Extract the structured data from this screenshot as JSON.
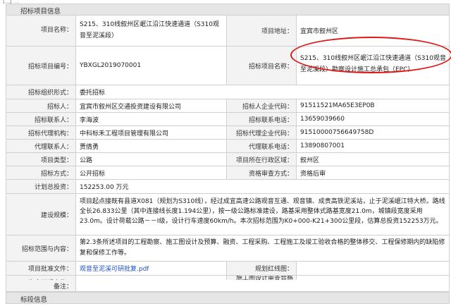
{
  "header_partial": "【...】...",
  "section1_title": "招标项目信息",
  "section2_title": "标段信息",
  "labels": {
    "project_name": "项目名称：",
    "project_address": "项目地址：",
    "tender_code": "招标项目编号：",
    "tender_name": "招标项目名称：",
    "org_form": "招标组织形式：",
    "tenderer": "招标人：",
    "tenderer_code": "招标人企业代码：",
    "tenderer_contact": "招标联系人：",
    "tenderer_phone": "招标联系电话：",
    "agency": "招标代理机构：",
    "agency_code": "招标代理企业代码：",
    "agent_contact": "代理联系人：",
    "agent_phone": "代理联系电话：",
    "project_type": "项目类型：",
    "region": "项目所在行政区域：",
    "tender_method": "招标方式：",
    "review_method": "资格审查方式：",
    "investment": "计划总投资：",
    "scale": "建设规模：",
    "scope": "招标范围与内容：",
    "approval_file": "项目批准文件：",
    "redline": "规划红线图：",
    "fund_proof": "资金证明文件：",
    "review_cert": "施工图设计审查合格书：",
    "remark": "备注："
  },
  "values": {
    "project_name": "S215、310线叙州区岷江沿江快速通道（S310观音至泥溪段）",
    "project_address": "宜宾市叙州区",
    "tender_code": "YBXGL2019070001",
    "tender_name": "S215、310线叙州区岷江沿江快速通道（S310观音至泥溪段）勘察设计施工总承包（EPC）",
    "org_form": "委托招标",
    "tenderer": "宜宾市叙州区交通投资建设有限公司",
    "tenderer_code": "91511521MA65E3EP0B",
    "tenderer_contact": "李海波",
    "tenderer_phone": "13659039660",
    "agency": "中科标禾工程项目管理有限公司",
    "agency_code": "91510000756649758D",
    "agent_contact": "贾倩勇",
    "agent_phone": "13890807001",
    "project_type": "公路",
    "region": "叙州区",
    "tender_method": "公开招标",
    "review_method": "资格后审",
    "investment": "152253.00 万元",
    "scale": "项目起点接既有县道X081（规划为S310线），经过成宜高速公路观音互通、观音镇、成贵高铁泥溪站，止于泥溪岷江特大桥。路线全长26.833公里（其中连接线长度1.194公里），按一级公路标准建设，路基采用整体式路基宽度21.0m，城镇段宽度采用23.0m。设计荷载公路－－I级，设计行车速度60km/h。本次招标范围为K0+000-K21+300公里段，估算总投资152253万元。",
    "scope": "第2.3条所述项目的工程勘察、施工图设计及预算、融资、工程采购、工程施工及竣工验收合格的整体移交、工程保修期内的缺陷修复和保修工作等。",
    "approval_file": "观音至泥溪可研批复.pdf",
    "redline": "",
    "fund_proof": "",
    "review_cert": "",
    "remark": ""
  }
}
